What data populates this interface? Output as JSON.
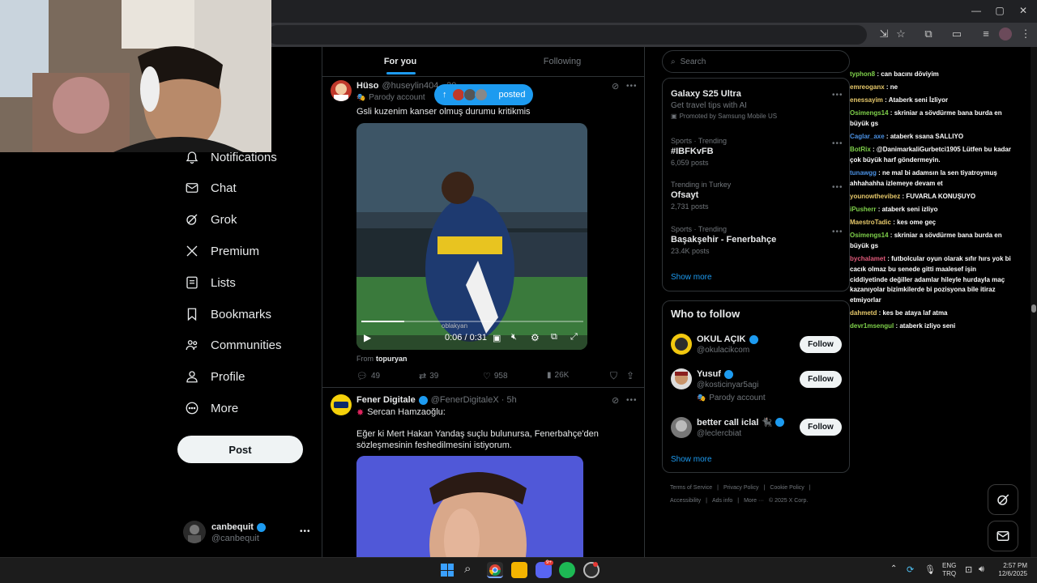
{
  "nav": [
    {
      "label": "Notifications",
      "icon": "bell-icon"
    },
    {
      "label": "Chat",
      "icon": "mail-icon"
    },
    {
      "label": "Grok",
      "icon": "grok-icon"
    },
    {
      "label": "Premium",
      "icon": "x-logo-icon"
    },
    {
      "label": "Lists",
      "icon": "list-icon"
    },
    {
      "label": "Bookmarks",
      "icon": "bookmark-icon"
    },
    {
      "label": "Communities",
      "icon": "people-icon"
    },
    {
      "label": "Profile",
      "icon": "person-icon"
    },
    {
      "label": "More",
      "icon": "more-circle-icon"
    }
  ],
  "post_button": "Post",
  "account": {
    "name": "canbequit",
    "handle": "@canbequit"
  },
  "tabs": {
    "for_you": "For you",
    "following": "Following"
  },
  "posted_pill": "posted",
  "post1": {
    "name": "Hüso",
    "handle": "@huseylin404 · 20",
    "parody": "Parody account",
    "text": "Gsli kuzenim kanser olmuş durumu kritikmis",
    "video_time": "0:06 / 0:31",
    "from_label": "From",
    "from_user": "topuryan",
    "watermark": "oblakyan",
    "stats": {
      "replies": "49",
      "reposts": "39",
      "likes": "958",
      "views": "26K"
    }
  },
  "post2": {
    "name": "Fener Digitale",
    "handle": "@FenerDigitaleX · 5h",
    "line1": "Sercan Hamzaoğlu:",
    "line2": "Eğer ki Mert Hakan Yandaş suçlu bulunursa, Fenerbahçe'den sözleşmesinin feshedilmesini istiyorum."
  },
  "search_placeholder": "Search",
  "trends": [
    {
      "meta": "",
      "title": "Galaxy S25 Ultra",
      "sub": "Get travel tips with AI",
      "extra": "Promoted by Samsung Mobile US"
    },
    {
      "meta": "Sports · Trending",
      "title": "#IBFKvFB",
      "sub": "6,059 posts"
    },
    {
      "meta": "Trending in Turkey",
      "title": "Ofsayt",
      "sub": "2,731 posts"
    },
    {
      "meta": "Sports · Trending",
      "title": "Başakşehir - Fenerbahçe",
      "sub": "23.4K posts"
    }
  ],
  "show_more": "Show more",
  "who_to_follow": "Who to follow",
  "suggestions": [
    {
      "name": "OKUL AÇIK",
      "handle": "@okulacikcom",
      "extra": ""
    },
    {
      "name": "Yusuf",
      "handle": "@kosticinyar5agi",
      "extra": "Parody account"
    },
    {
      "name": "better call iclal 🐈‍⬛",
      "handle": "@leclercbiat",
      "extra": ""
    }
  ],
  "follow_label": "Follow",
  "footer": {
    "line1": [
      "Terms of Service",
      "Privacy Policy",
      "Cookie Policy"
    ],
    "line2": [
      "Accessibility",
      "Ads info",
      "More ···",
      "© 2025 X Corp."
    ]
  },
  "chat": [
    {
      "user": "typhon8",
      "color": "#7fd14a",
      "msg": ": can bacını döviyim"
    },
    {
      "user": "emreoganx",
      "color": "#e6c86a",
      "msg": ": ne"
    },
    {
      "user": "enessayim",
      "color": "#e6c86a",
      "msg": ": Ataberk seni İzliyor"
    },
    {
      "user": "Osimengs14",
      "color": "#7fd14a",
      "msg": ": skriniar a sövdürme bana burda en büyük gs"
    },
    {
      "user": "Caglar_axe",
      "color": "#4a90e2",
      "msg": ": ataberk ssana SALLIYO"
    },
    {
      "user": "BotRix",
      "color": "#7fd14a",
      "msg": ": @DanimarkaliGurbetci1905 Lütfen bu kadar çok büyük harf göndermeyin."
    },
    {
      "user": "tunawgg",
      "color": "#4a90e2",
      "msg": ": ne mal bi adamsın la sen tiyatroymuş ahhahahha izlemeye devam et"
    },
    {
      "user": "younowthevibez",
      "color": "#e6c86a",
      "msg": ": FUVARLA KONUŞUYO"
    },
    {
      "user": "iPusherr",
      "color": "#7fd14a",
      "msg": ": ataberk seni izliyo"
    },
    {
      "user": "MaestroTadic",
      "color": "#e6c86a",
      "msg": ": kes ome geç"
    },
    {
      "user": "Osimengs14",
      "color": "#7fd14a",
      "msg": ": skriniar a sövdürme bana burda en büyük gs"
    },
    {
      "user": "bychalamet",
      "color": "#e05a7a",
      "msg": ": futbolcular oyun olarak sıfır hırs yok bi cacık olmaz bu senede gitti maalesef işin ciddiyetinde değiller adamlar hileyle hurdayla maç kazanıyolar bizimkilerde bi pozisyona bile itiraz etmiyorlar"
    },
    {
      "user": "dahmetd",
      "color": "#e6c86a",
      "msg": ": kes be ataya laf atma"
    },
    {
      "user": "devr1msengul",
      "color": "#7fd14a",
      "msg": ": ataberk izliyo seni"
    }
  ],
  "taskbar": {
    "lang1": "ENG",
    "lang2": "TRQ",
    "time": "2:57 PM",
    "date": "12/6/2025",
    "discord_badge": "9+"
  }
}
